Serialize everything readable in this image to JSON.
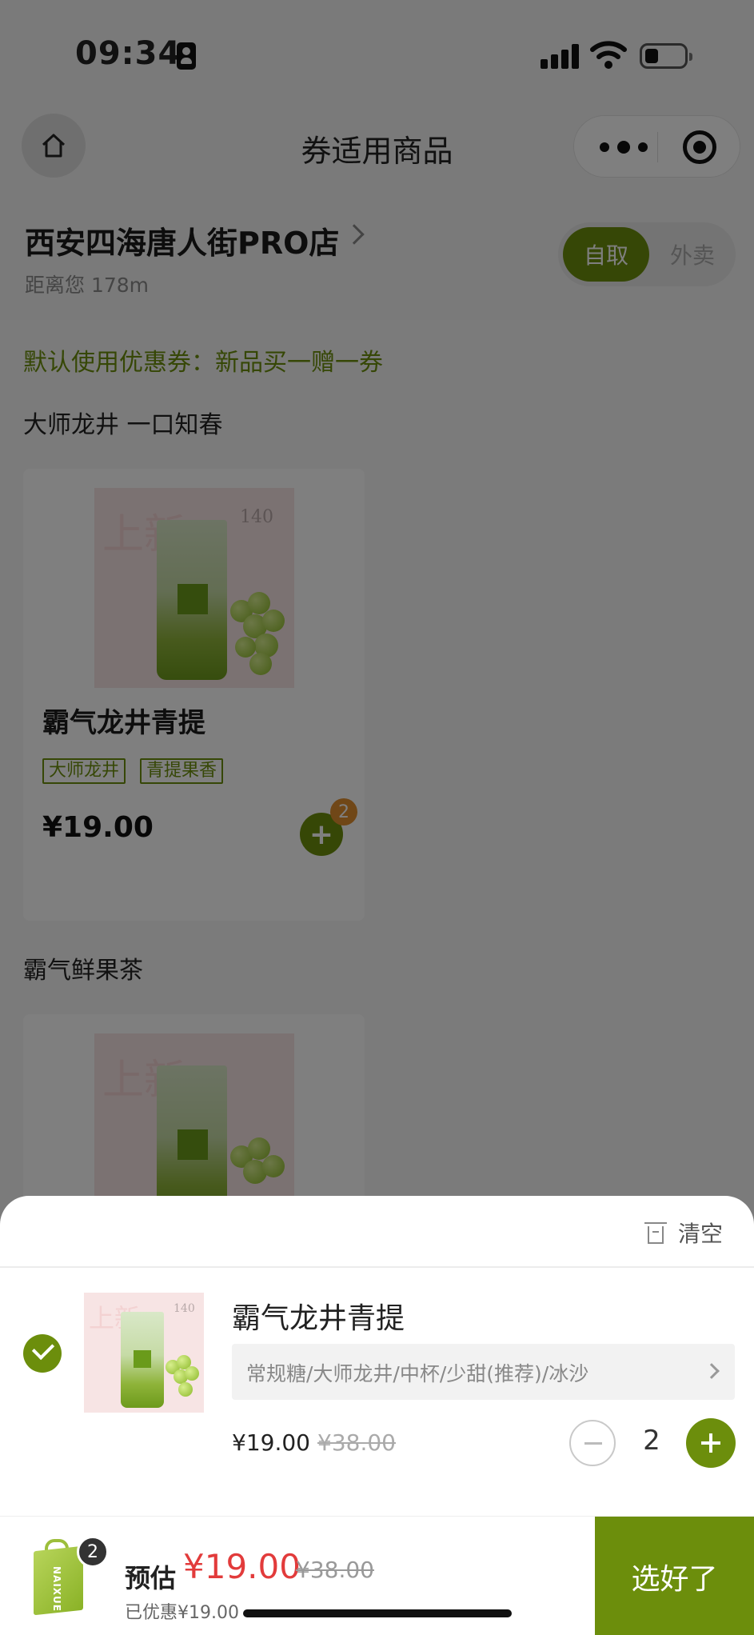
{
  "status_bar": {
    "time": "09:34"
  },
  "nav": {
    "title": "券适用商品"
  },
  "store": {
    "name": "西安四海唐人街PRO店",
    "distance": "距离您 178m",
    "mode_active": "自取",
    "mode_other": "外卖"
  },
  "content": {
    "coupon_line": "默认使用优惠券：新品买一赠一券",
    "sections": [
      {
        "title": "大师龙井 一口知春",
        "product": {
          "name": "霸气龙井青提",
          "tags": [
            "大师龙井",
            "青提果香"
          ],
          "price": "¥19.00",
          "cart_count": "2",
          "image_text": "上新",
          "image_calorie": "140"
        }
      },
      {
        "title": "霸气鲜果茶",
        "product": {
          "image_text": "上新"
        }
      }
    ]
  },
  "sheet": {
    "clear_label": "清空",
    "item": {
      "name": "霸气龙井青提",
      "spec": "常规糖/大师龙井/中杯/少甜(推荐)/冰沙",
      "price": "¥19.00",
      "original_price": "¥38.00",
      "quantity": "2",
      "image_text": "上新",
      "image_calorie": "140"
    }
  },
  "bottom_bar": {
    "bag_count": "2",
    "bag_text": "NAIXUE",
    "estimate_label": "预估",
    "estimate_price": "¥19.00",
    "original_price": "¥38.00",
    "saved_text": "已优惠¥19.00",
    "confirm_label": "选好了"
  },
  "colors": {
    "accent": "#6c8e0c",
    "price_red": "#e23b3b",
    "badge_orange": "#e08e2e"
  }
}
